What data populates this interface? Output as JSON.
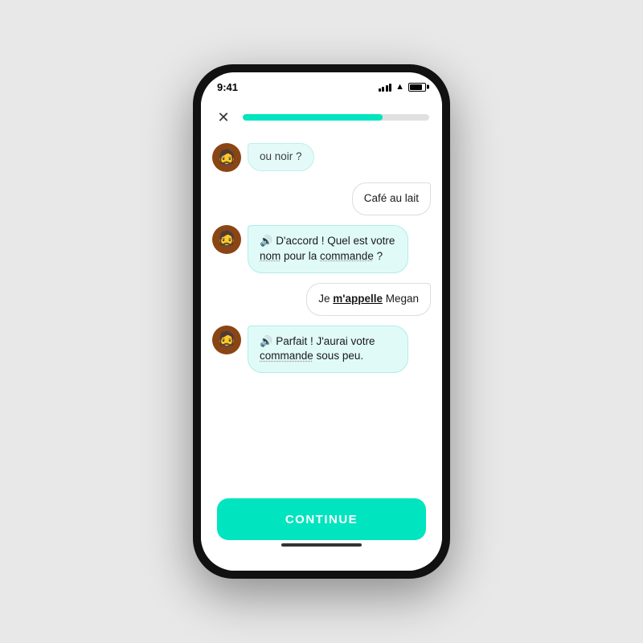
{
  "status_bar": {
    "time": "9:41"
  },
  "header": {
    "close_label": "✕",
    "progress_percent": 75
  },
  "chat": {
    "partial_message": "ou noir ?",
    "messages": [
      {
        "type": "user",
        "text": "Café au lait",
        "bold_word": null
      },
      {
        "type": "bot",
        "has_sound": true,
        "sound_emoji": "🔊",
        "text_parts": [
          {
            "text": "D'accord ! Quel est votre ",
            "style": "normal"
          },
          {
            "text": "nom",
            "style": "dotted"
          },
          {
            "text": " pour la ",
            "style": "normal"
          },
          {
            "text": "commande",
            "style": "dotted"
          },
          {
            "text": " ?",
            "style": "normal"
          }
        ]
      },
      {
        "type": "user",
        "text_parts": [
          {
            "text": "Je ",
            "style": "normal"
          },
          {
            "text": "m'appelle",
            "style": "bold-underline"
          },
          {
            "text": " Megan",
            "style": "normal"
          }
        ]
      },
      {
        "type": "bot",
        "has_sound": true,
        "sound_emoji": "🔊",
        "text_parts": [
          {
            "text": "Parfait ! J'aurai votre ",
            "style": "normal"
          },
          {
            "text": "commande",
            "style": "dotted"
          },
          {
            "text": " sous peu.",
            "style": "normal"
          }
        ]
      }
    ]
  },
  "continue_button": {
    "label": "CONTINUE"
  },
  "avatar_emoji": "🧔",
  "icons": {
    "close": "✕",
    "sound": "🔊"
  }
}
